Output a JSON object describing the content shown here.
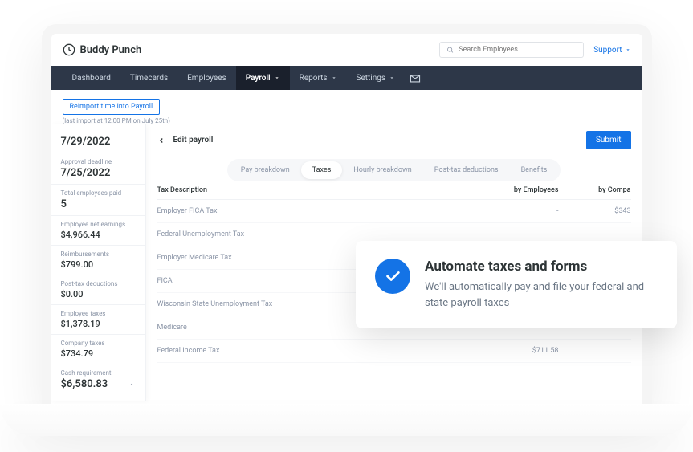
{
  "brand": {
    "name": "Buddy Punch"
  },
  "search": {
    "placeholder": "Search Employees"
  },
  "support": {
    "label": "Support"
  },
  "nav": {
    "items": [
      {
        "label": "Dashboard"
      },
      {
        "label": "Timecards"
      },
      {
        "label": "Employees"
      },
      {
        "label": "Payroll"
      },
      {
        "label": "Reports"
      },
      {
        "label": "Settings"
      }
    ]
  },
  "reimport": {
    "button": "Reimport time into Payroll",
    "note": "(last import at 12:00 PM on July 25th)"
  },
  "sidebar": {
    "payroll_date": "7/29/2022",
    "approval_label": "Approval deadline",
    "approval_date": "7/25/2022",
    "total_label": "Total employees paid",
    "total_value": "5",
    "net_label": "Employee net earnings",
    "net_value": "$4,966.44",
    "reimb_label": "Reimbursements",
    "reimb_value": "$799.00",
    "posttax_label": "Post-tax deductions",
    "posttax_value": "$0.00",
    "emp_tax_label": "Employee taxes",
    "emp_tax_value": "$1,378.19",
    "comp_tax_label": "Company taxes",
    "comp_tax_value": "$734.79",
    "cash_label": "Cash requirement",
    "cash_value": "$6,580.83"
  },
  "panel": {
    "title": "Edit payroll",
    "submit": "Submit"
  },
  "tabs": {
    "items": [
      {
        "label": "Pay breakdown"
      },
      {
        "label": "Taxes"
      },
      {
        "label": "Hourly breakdown"
      },
      {
        "label": "Post-tax deductions"
      },
      {
        "label": "Benefits"
      }
    ]
  },
  "table": {
    "head": {
      "desc": "Tax Description",
      "emp": "by Employees",
      "comp": "by Compa"
    },
    "rows": [
      {
        "desc": "Employer FICA Tax",
        "emp": "-",
        "comp": "$343"
      },
      {
        "desc": "Federal Unemployment Tax",
        "emp": "",
        "comp": ""
      },
      {
        "desc": "Employer Medicare Tax",
        "emp": "",
        "comp": ""
      },
      {
        "desc": "FICA",
        "emp": "",
        "comp": ""
      },
      {
        "desc": "Wisconsin State Unemployment Tax",
        "emp": "",
        "comp": ""
      },
      {
        "desc": "Medicare",
        "emp": "",
        "comp": ""
      },
      {
        "desc": "Federal Income Tax",
        "emp": "$711.58",
        "comp": ""
      }
    ]
  },
  "callout": {
    "title": "Automate taxes and forms",
    "text": "We'll automatically pay and file your federal and state payroll taxes"
  }
}
